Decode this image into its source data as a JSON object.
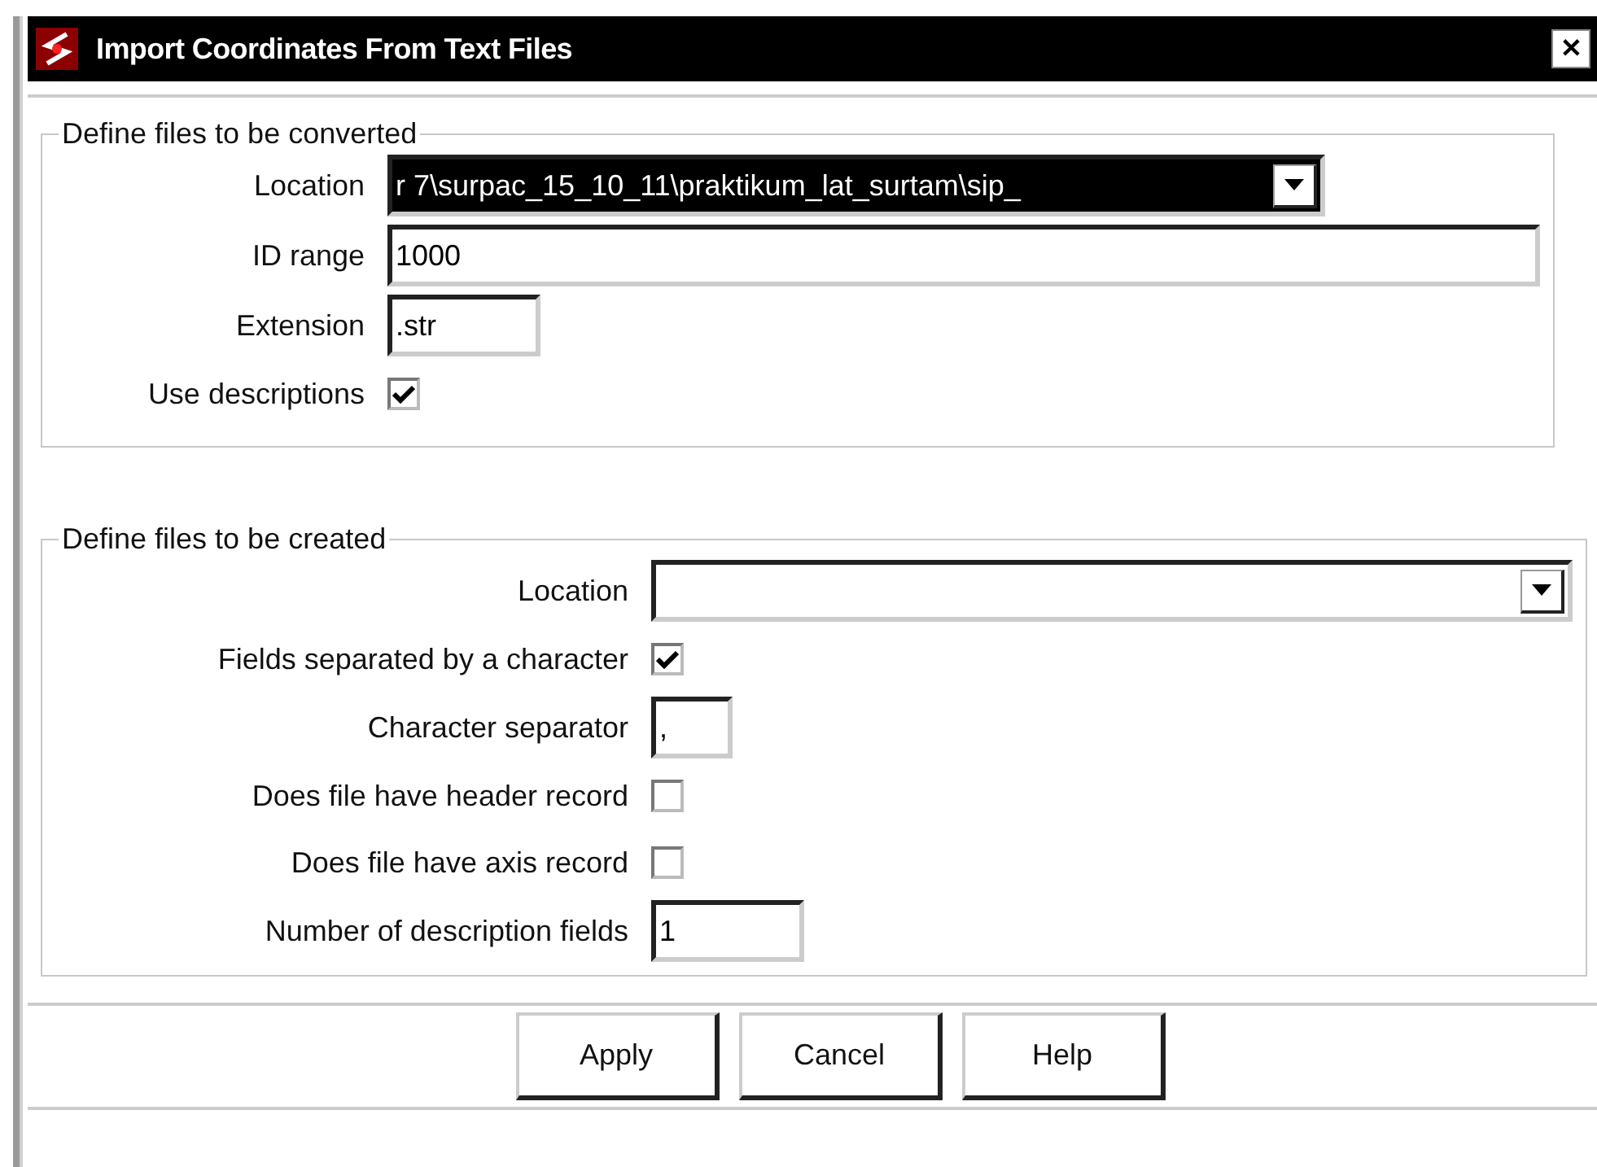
{
  "window": {
    "title": "Import Coordinates From Text Files",
    "close": "✕"
  },
  "sections": [
    {
      "title": "Define files to be converted",
      "rows": [
        {
          "kind": "combo",
          "label": "Location",
          "value": "r 7\\surpac_15_10_11\\praktikum_lat_surtam\\sip_",
          "highlighted": true
        },
        {
          "kind": "text",
          "label": "ID range",
          "value": "1000"
        },
        {
          "kind": "text",
          "label": "Extension",
          "value": ".str"
        },
        {
          "kind": "checkbox",
          "label": "Use descriptions",
          "checked": true
        }
      ]
    },
    {
      "title": "Define files to be created",
      "rows": [
        {
          "kind": "combo",
          "label": "Location",
          "highlighted": false
        },
        {
          "kind": "checkbox",
          "label": "Fields separated by a character",
          "checked": true
        },
        {
          "kind": "text",
          "label": "Character separator",
          "value": ","
        },
        {
          "kind": "checkbox",
          "label": "Does file have header record",
          "checked": false
        },
        {
          "kind": "checkbox",
          "label": "Does file have axis record",
          "checked": false
        },
        {
          "kind": "text",
          "label": "Number of description fields",
          "value": "1"
        }
      ]
    }
  ],
  "buttons": [
    "Apply",
    "Cancel",
    "Help"
  ]
}
